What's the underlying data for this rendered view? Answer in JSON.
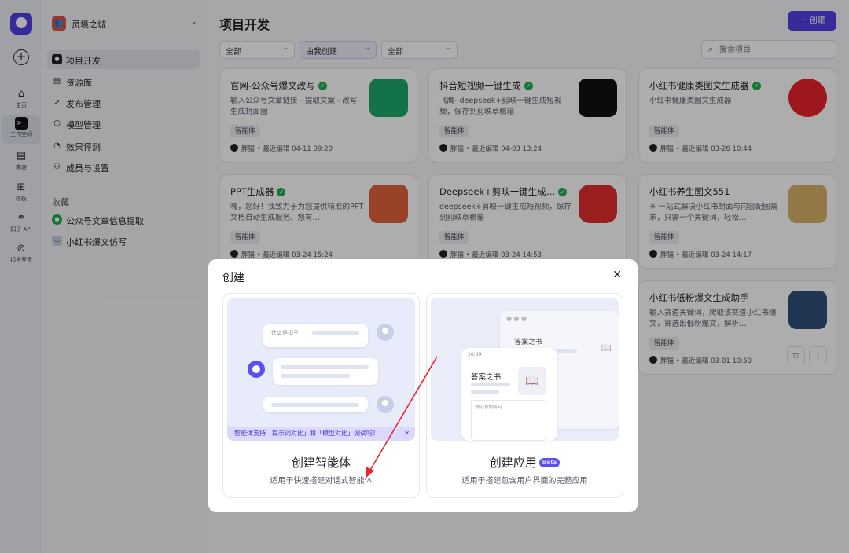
{
  "rail": {
    "items": [
      {
        "label": "主页",
        "icon": "home-icon"
      },
      {
        "label": "工作空间",
        "icon": "workspace-icon"
      },
      {
        "label": "商店",
        "icon": "store-icon"
      },
      {
        "label": "模板",
        "icon": "template-icon"
      },
      {
        "label": "扣子 API",
        "icon": "api-icon"
      },
      {
        "label": "扣子罗盘",
        "icon": "compass-icon"
      }
    ]
  },
  "sidebar": {
    "workspace": "灵境之城",
    "nav": [
      {
        "label": "项目开发",
        "icon": "project-icon"
      },
      {
        "label": "资源库",
        "icon": "library-icon"
      },
      {
        "label": "发布管理",
        "icon": "rocket-icon"
      },
      {
        "label": "模型管理",
        "icon": "model-icon"
      },
      {
        "label": "效果评测",
        "icon": "evaluation-icon"
      },
      {
        "label": "成员与设置",
        "icon": "members-icon"
      }
    ],
    "favorites_heading": "收藏",
    "favorites": [
      {
        "label": "公众号文章信息提取"
      },
      {
        "label": "小红书爆文仿写"
      }
    ]
  },
  "header": {
    "title": "项目开发",
    "create_label": "创建",
    "filters": [
      "全部",
      "由我创建",
      "全部"
    ],
    "search_placeholder": "搜索项目"
  },
  "cards": [
    {
      "title": "官网-公众号爆文改写",
      "verified": true,
      "desc": "输入公众号文章链接 - 提取文案 - 改写-生成封面图",
      "tag": "智能体",
      "meta": "胖猫 • 最近编辑 04-11 09:20",
      "icon_color": "#1ea86a"
    },
    {
      "title": "抖音短视频一键生成",
      "verified": true,
      "desc": "飞鹰- deepseek+剪映一键生成短视频，保存到剪映草稿箱",
      "tag": "智能体",
      "meta": "胖猫 • 最近编辑 04-03 13:24",
      "icon_color": "#111111"
    },
    {
      "title": "小红书健康类图文生成器",
      "verified": true,
      "desc": "小红书健康类图文生成器",
      "tag": "智能体",
      "meta": "胖猫 • 最近编辑 03-26 10:44",
      "icon_color": "#e8222a"
    },
    {
      "title": "PPT生成器",
      "verified": true,
      "desc": "嗨，您好！我致力于为您提供精准的PPT文档自动生成服务。您有…",
      "tag": "智能体",
      "meta": "胖猫 • 最近编辑 03-24 15:24",
      "icon_color": "#e0633a"
    },
    {
      "title": "Deepseek+剪映一键生成…",
      "verified": true,
      "desc": "deepseek+剪映一键生成短视频，保存到剪映草稿箱",
      "tag": "智能体",
      "meta": "胖猫 • 最近编辑 03-24 14:53",
      "icon_color": "#e2302d"
    },
    {
      "title": "小红书养生图文551",
      "verified": false,
      "desc": "☀ 一站式解决小红书封面与内容配图需求，只需一个关键词，轻松…",
      "tag": "智能体",
      "meta": "胖猫 • 最近编辑 03-24 14:17",
      "icon_color": "#d9b36a"
    },
    {
      "title": "小红书低粉爆文生成助手",
      "verified": false,
      "desc": "输入赛道关键词，爬取该赛道小红书爆文，筛选出低粉爆文，解析…",
      "tag": "智能体",
      "meta": "胖猫 • 最近编辑 03-01 10:50",
      "icon_color": "#2f4f7a"
    }
  ],
  "modal": {
    "title": "创建",
    "options": [
      {
        "name": "创建智能体",
        "desc": "适用于快速搭建对话式智能体",
        "beta": ""
      },
      {
        "name": "创建应用",
        "desc": "适用于搭建包含用户界面的完整应用",
        "beta": "Beta"
      }
    ],
    "agent_preview": {
      "question": "什么是扣子",
      "tip": "智能体支持「提示词对比」和「模型对比」调试啦！"
    },
    "app_preview": {
      "time": "10:09",
      "app_name": "答案之书",
      "input_hint": "核心意的疑问"
    }
  },
  "colors": {
    "accent": "#4e40e5",
    "verified": "#1fae4e",
    "annotation_arrow": "#e8262b"
  }
}
